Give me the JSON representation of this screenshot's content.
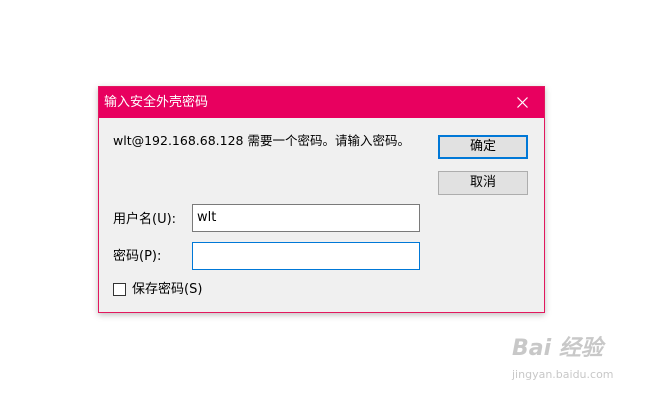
{
  "dialog": {
    "title": "输入安全外壳密码",
    "close_symbol": "✕",
    "message": "wlt@192.168.68.128 需要一个密码。请输入密码。",
    "ok_label": "确定",
    "cancel_label": "取消",
    "username_label": "用户名(U):",
    "username_value": "wlt",
    "password_label": "密码(P):",
    "password_value": "",
    "save_password_label": "保存密码(S)",
    "save_password_checked": false
  },
  "colors": {
    "titlebar": "#e8005f",
    "accent": "#0078d7"
  },
  "watermark": {
    "logo": "Bai 经验",
    "sub": "jingyan.baidu.com"
  }
}
